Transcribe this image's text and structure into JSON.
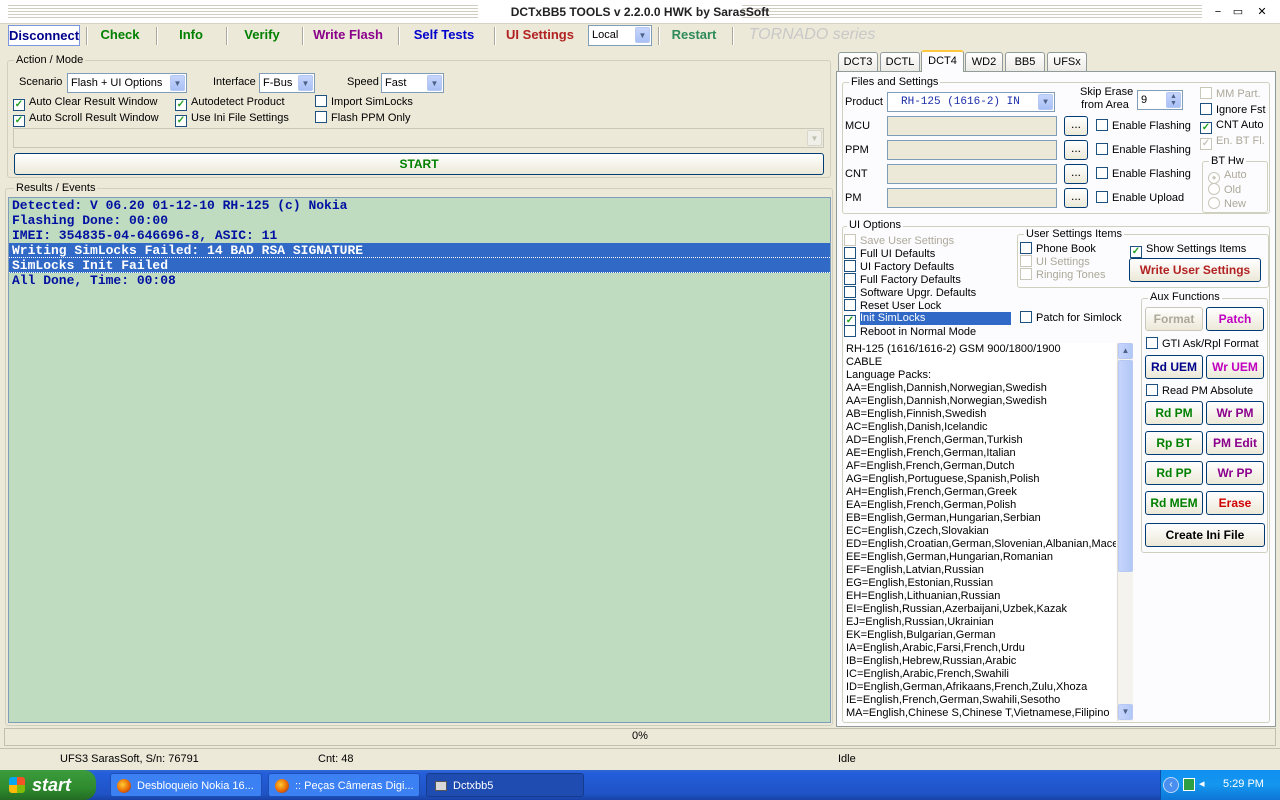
{
  "window": {
    "title": "DCTxBB5 TOOLS v 2.2.0.0 HWK by SarasSoft",
    "minimize": "−",
    "restore": "▭",
    "close": "✕"
  },
  "toolbar": {
    "disconnect": "Disconnect",
    "check": "Check",
    "info": "Info",
    "verify": "Verify",
    "write_flash": "Write Flash",
    "self_tests": "Self Tests",
    "ui_settings": "UI Settings",
    "mode_value": "Local",
    "restart": "Restart",
    "series": "TORNADO series",
    "colors": {
      "disconnect": "#00008b",
      "check": "#008000",
      "info": "#008000",
      "verify": "#008000",
      "write_flash": "#8b008b",
      "self_tests": "#0000cd",
      "ui_settings": "#b22222",
      "restart": "#2e8b57",
      "series": "#c8c8c8"
    }
  },
  "action_mode": {
    "legend": "Action / Mode",
    "scenario_label": "Scenario",
    "scenario_value": "Flash + UI Options",
    "interface_label": "Interface",
    "interface_value": "F-Bus",
    "speed_label": "Speed",
    "speed_value": "Fast",
    "checks": [
      {
        "label": "Auto Clear Result Window",
        "checked": true
      },
      {
        "label": "Auto Scroll Result Window",
        "checked": true
      },
      {
        "label": "Autodetect Product",
        "checked": true
      },
      {
        "label": "Use Ini File Settings",
        "checked": true
      },
      {
        "label": "Import SimLocks",
        "checked": false
      },
      {
        "label": "Flash PPM Only",
        "checked": false
      }
    ],
    "start_label": "START"
  },
  "results": {
    "legend": "Results / Events",
    "lines": [
      {
        "text": "Detected: V 06.20 01-12-10 RH-125 (c) Nokia",
        "hl": false
      },
      {
        "text": "Flashing Done: 00:00",
        "hl": false
      },
      {
        "text": "IMEI: 354835-04-646696-8, ASIC: 11",
        "hl": false
      },
      {
        "text": "Writing SimLocks Failed: 14 BAD RSA SIGNATURE",
        "hl": true
      },
      {
        "text": "SimLocks Init Failed",
        "hl": true
      },
      {
        "text": "All Done, Time: 00:08",
        "hl": false
      }
    ]
  },
  "tabs": [
    "DCT3",
    "DCTL",
    "DCT4",
    "WD2",
    "BB5",
    "UFSx"
  ],
  "active_tab": "DCT4",
  "files": {
    "legend": "Files and Settings",
    "product_label": "Product",
    "product_value": "RH-125 (1616-2) IN",
    "skip_erase_label_1": "Skip Erase",
    "skip_erase_label_2": "from Area",
    "skip_erase_value": "9",
    "rows": [
      {
        "label": "MCU",
        "check": "Enable Flashing"
      },
      {
        "label": "PPM",
        "check": "Enable Flashing"
      },
      {
        "label": "CNT",
        "check": "Enable Flashing"
      },
      {
        "label": "PM",
        "check": "Enable Upload"
      }
    ],
    "browse": "...",
    "right_checks": [
      {
        "label": "MM Part.",
        "checked": false,
        "disabled": true
      },
      {
        "label": "Ignore Fst",
        "checked": false,
        "disabled": false
      },
      {
        "label": "CNT Auto",
        "checked": true,
        "disabled": false
      },
      {
        "label": "En. BT Fl.",
        "checked": true,
        "disabled": true
      }
    ],
    "bt_hw": {
      "legend": "BT Hw",
      "options": [
        "Auto",
        "Old",
        "New"
      ]
    }
  },
  "ui_options": {
    "legend": "UI Options",
    "items": [
      {
        "label": "Save User Settings",
        "checked": false,
        "disabled": true,
        "hl": false
      },
      {
        "label": "Full UI Defaults",
        "checked": false,
        "disabled": false,
        "hl": false
      },
      {
        "label": "UI Factory Defaults",
        "checked": false,
        "disabled": false,
        "hl": false
      },
      {
        "label": "Full Factory Defaults",
        "checked": false,
        "disabled": false,
        "hl": false
      },
      {
        "label": "Software Upgr. Defaults",
        "checked": false,
        "disabled": false,
        "hl": false
      },
      {
        "label": "Reset User Lock",
        "checked": false,
        "disabled": false,
        "hl": false
      },
      {
        "label": "Init SimLocks",
        "checked": true,
        "disabled": false,
        "hl": true
      },
      {
        "label": "Reboot in Normal Mode",
        "checked": false,
        "disabled": false,
        "hl": false
      }
    ],
    "patch_simlock": "Patch for Simlock",
    "user_settings": {
      "legend": "User Settings Items",
      "items": [
        {
          "label": "Phone Book",
          "checked": false,
          "disabled": false
        },
        {
          "label": "UI Settings",
          "checked": false,
          "disabled": true
        },
        {
          "label": "Ringing Tones",
          "checked": false,
          "disabled": true
        }
      ],
      "show_label": "Show Settings Items",
      "show_checked": true,
      "write_button": "Write User Settings"
    }
  },
  "info_list": [
    "      RH-125 (1616/1616-2) GSM 900/1800/1900",
    "CABLE",
    "Language Packs:",
    "AA=English,Dannish,Norwegian,Swedish",
    "AA=English,Dannish,Norwegian,Swedish",
    "AB=English,Finnish,Swedish",
    "AC=English,Danish,Icelandic",
    "AD=English,French,German,Turkish",
    "AE=English,French,German,Italian",
    "AF=English,French,German,Dutch",
    "AG=English,Portuguese,Spanish,Polish",
    "AH=English,French,German,Greek",
    "EA=English,French,German,Polish",
    "EB=English,German,Hungarian,Serbian",
    "EC=English,Czech,Slovakian",
    "ED=English,Croatian,German,Slovenian,Albanian,Macedo",
    "EE=English,German,Hungarian,Romanian",
    "EF=English,Latvian,Russian",
    "EG=English,Estonian,Russian",
    "EH=English,Lithuanian,Russian",
    "EI=English,Russian,Azerbaijani,Uzbek,Kazak",
    "EJ=English,Russian,Ukrainian",
    "EK=English,Bulgarian,German",
    "IA=English,Arabic,Farsi,French,Urdu",
    "IB=English,Hebrew,Russian,Arabic",
    "IC=English,Arabic,French,Swahili",
    "ID=English,German,Afrikaans,French,Zulu,Xhoza",
    "IE=English,French,German,Swahili,Sesotho",
    "MA=English,Chinese S,Chinese T,Vietnamese,Filipino"
  ],
  "aux": {
    "legend": "Aux Functions",
    "format": "Format",
    "patch": "Patch",
    "gti_label": "GTI Ask/Rpl Format",
    "rd_uem": "Rd UEM",
    "wr_uem": "Wr UEM",
    "read_pm_label": "Read PM Absolute",
    "rd_pm": "Rd PM",
    "wr_pm": "Wr PM",
    "rp_bt": "Rp BT",
    "pm_edit": "PM Edit",
    "rd_pp": "Rd PP",
    "wr_pp": "Wr PP",
    "rd_mem": "Rd MEM",
    "erase": "Erase",
    "create_ini": "Create Ini File"
  },
  "progress": {
    "text": "0%",
    "value": 0
  },
  "status": {
    "serial": "UFS3 SarasSoft, S/n: 76791",
    "cnt": "Cnt: 48",
    "state": "Idle"
  },
  "taskbar": {
    "start": "start",
    "tasks": [
      "Desbloqueio Nokia 16...",
      ":: Peças Câmeras Digi...",
      "Dctxbb5"
    ],
    "clock": "5:29 PM"
  }
}
